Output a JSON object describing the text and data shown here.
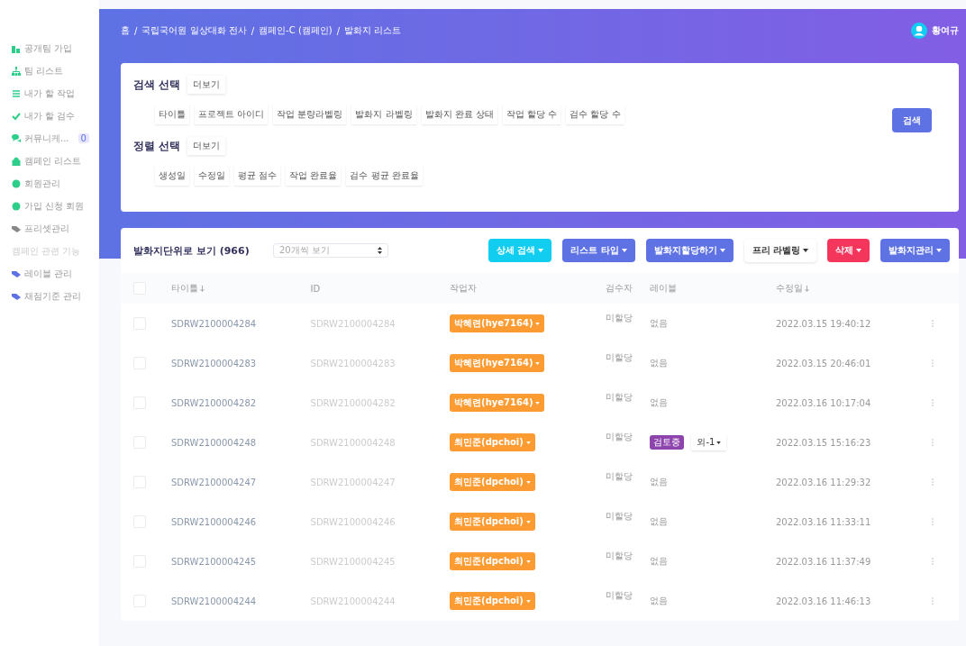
{
  "sidebar": {
    "items": [
      {
        "label": "공개팀 가입",
        "kind": "item"
      },
      {
        "label": "팀 리스트",
        "kind": "item"
      },
      {
        "label": "내가 할 작업",
        "kind": "item"
      },
      {
        "label": "내가 할 검수",
        "kind": "item"
      },
      {
        "label": "커뮤니케...",
        "kind": "item",
        "badge": "0"
      },
      {
        "label": "캠페인 리스트",
        "kind": "item"
      },
      {
        "label": "회원관리",
        "kind": "item"
      },
      {
        "label": "가입 신청 회원",
        "kind": "item"
      },
      {
        "label": "프리셋관리",
        "kind": "item"
      },
      {
        "label": "캠페인 관련 기능",
        "kind": "section"
      },
      {
        "label": "레이블 관리",
        "kind": "item"
      },
      {
        "label": "채점기준 관리",
        "kind": "item"
      }
    ]
  },
  "breadcrumb": {
    "separator": "/",
    "items": [
      "홈",
      "국립국어원 일상대화 전사",
      "캠페인-C (캠페인)",
      "발화지 리스트"
    ]
  },
  "user": {
    "name": "황여규"
  },
  "filters": [
    {
      "title": "검색 선택",
      "more": "더보기",
      "chips": [
        "타이틀",
        "프로젝트 아이디",
        "작업 분량라벨링",
        "발화지 라벨링",
        "발화지 완료 상태",
        "작업 할당 수",
        "검수 할당 수"
      ]
    },
    {
      "title": "정렬 선택",
      "more": "더보기",
      "chips": [
        "생성일",
        "수정일",
        "평균 점수",
        "작업 완료율",
        "검수 평균 완료율"
      ]
    }
  ],
  "search_button": "검색",
  "list": {
    "title": "발화지단위로 보기 (966)",
    "page_size": "20개씩 보기",
    "buttons": [
      {
        "label": "상세 검색",
        "kind": "cyan"
      },
      {
        "label": "리스트 타입",
        "kind": "primary"
      },
      {
        "label": "발화지할당하기",
        "kind": "primary"
      },
      {
        "label": "프리 라벨링",
        "kind": "light"
      },
      {
        "label": "삭제",
        "kind": "danger"
      },
      {
        "label": "발화지관리",
        "kind": "primary"
      }
    ],
    "columns": [
      {
        "label": "타이틀",
        "sort": true
      },
      {
        "label": "ID",
        "sort": false
      },
      {
        "label": "작업자",
        "sort": false
      },
      {
        "label": "검수자",
        "sort": false
      },
      {
        "label": "레이블",
        "sort": false
      },
      {
        "label": "수정일",
        "sort": true
      }
    ],
    "header_checked": false,
    "rows": [
      {
        "checked": false,
        "title": "SDRW2100004284",
        "id": "SDRW2100004284",
        "worker": "박혜련(hye7164)",
        "reviewer": "미할당",
        "label": {
          "kind": "text",
          "text": "없음"
        },
        "date": "2022.03.15 19:40:12"
      },
      {
        "checked": false,
        "title": "SDRW2100004283",
        "id": "SDRW2100004283",
        "worker": "박혜련(hye7164)",
        "reviewer": "미할당",
        "label": {
          "kind": "text",
          "text": "없음"
        },
        "date": "2022.03.15 20:46:01"
      },
      {
        "checked": false,
        "title": "SDRW2100004282",
        "id": "SDRW2100004282",
        "worker": "박혜련(hye7164)",
        "reviewer": "미할당",
        "label": {
          "kind": "text",
          "text": "없음"
        },
        "date": "2022.03.16 10:17:04"
      },
      {
        "checked": false,
        "title": "SDRW2100004248",
        "id": "SDRW2100004248",
        "worker": "최민준(dpchoi)",
        "reviewer": "미할당",
        "label": {
          "kind": "tag",
          "text": "검토중",
          "more": "외-1"
        },
        "date": "2022.03.15 15:16:23"
      },
      {
        "checked": false,
        "title": "SDRW2100004247",
        "id": "SDRW2100004247",
        "worker": "최민준(dpchoi)",
        "reviewer": "미할당",
        "label": {
          "kind": "text",
          "text": "없음"
        },
        "date": "2022.03.16 11:29:32"
      },
      {
        "checked": false,
        "title": "SDRW2100004246",
        "id": "SDRW2100004246",
        "worker": "최민준(dpchoi)",
        "reviewer": "미할당",
        "label": {
          "kind": "text",
          "text": "없음"
        },
        "date": "2022.03.16 11:33:11"
      },
      {
        "checked": false,
        "title": "SDRW2100004245",
        "id": "SDRW2100004245",
        "worker": "최민준(dpchoi)",
        "reviewer": "미할당",
        "label": {
          "kind": "text",
          "text": "없음"
        },
        "date": "2022.03.16 11:37:49"
      },
      {
        "checked": false,
        "title": "SDRW2100004244",
        "id": "SDRW2100004244",
        "worker": "최민준(dpchoi)",
        "reviewer": "미할당",
        "label": {
          "kind": "text",
          "text": "없음"
        },
        "date": "2022.03.16 11:46:13"
      }
    ]
  }
}
